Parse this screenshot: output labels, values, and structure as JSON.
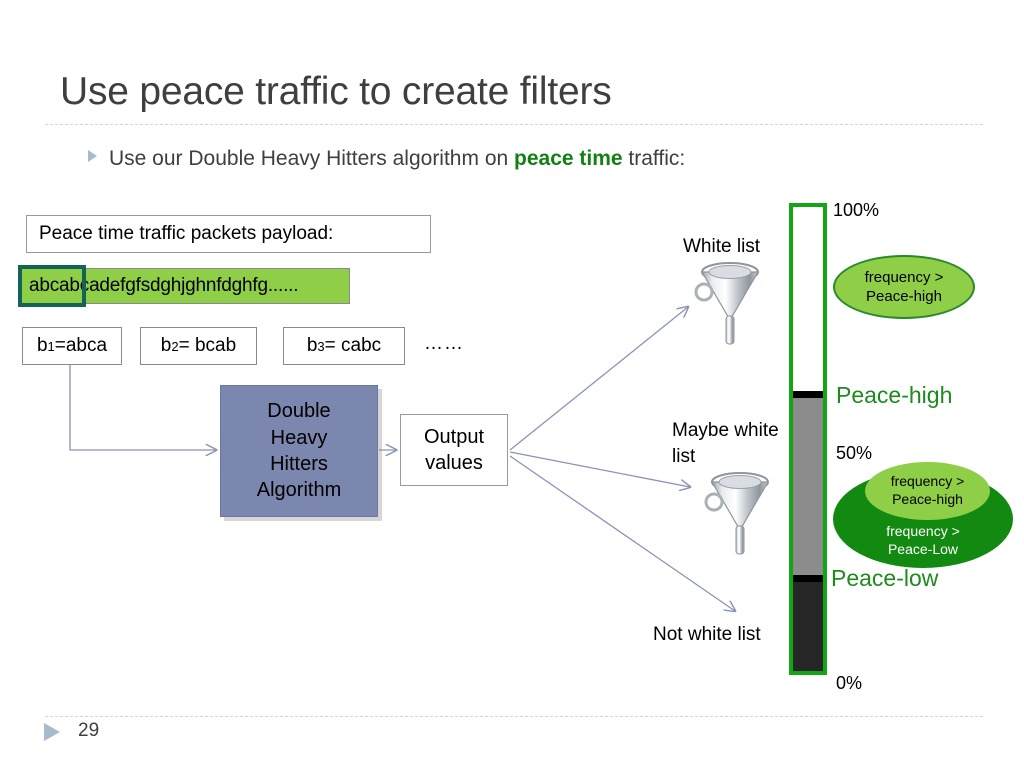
{
  "slide": {
    "title": "Use peace traffic to create filters",
    "page_number": "29"
  },
  "bullet": {
    "text_before": "Use our Double Heavy Hitters algorithm on ",
    "highlight": "peace time",
    "text_after": " traffic:",
    "highlight_color": "#128012"
  },
  "payload": {
    "caption": "Peace time traffic packets payload:",
    "string": "abcabcadefgfsdghjghnfdghfg......",
    "window_substring": "abcab",
    "bar_color": "#8fce47",
    "window_border_color": "#136356"
  },
  "blocks": [
    {
      "label_prefix": "b",
      "subscript": "1",
      "equals": "=abca"
    },
    {
      "label_prefix": "b",
      "subscript": "2",
      "equals": " = bcab"
    },
    {
      "label_prefix": "b",
      "subscript": "3",
      "equals": " = cabc"
    }
  ],
  "blocks_ellipsis": "……",
  "algorithm": {
    "line1": "Double",
    "line2": "Heavy",
    "line3": "Hitters",
    "line4": "Algorithm",
    "fill_color": "#7b87ae"
  },
  "output": {
    "line1": "Output",
    "line2": "values"
  },
  "destinations": {
    "white_list": "White list",
    "maybe_white_list": "Maybe white list",
    "not_white_list": "Not white list"
  },
  "gauge": {
    "tick_top": "100%",
    "tick_mid": "50%",
    "tick_bottom": "0%",
    "threshold_high": "Peace-high",
    "threshold_low": "Peace-low",
    "border_color": "#13a513",
    "segment_top_color": "#ffffff",
    "segment_mid_color": "#8c8c8c",
    "segment_bottom_color": "#262626",
    "label_color": "#1f8a1f"
  },
  "callouts": {
    "high": {
      "line1": "frequency >",
      "line2": "Peace-high",
      "fill_color": "#8fce47",
      "border_color": "#2a8a2a"
    },
    "low": {
      "inner_line1": "frequency >",
      "inner_line2": "Peace-high",
      "outer_line1": "frequency >",
      "outer_line2": "Peace-Low",
      "inner_fill_color": "#8fce47",
      "outer_fill_color": "#128a12"
    }
  }
}
